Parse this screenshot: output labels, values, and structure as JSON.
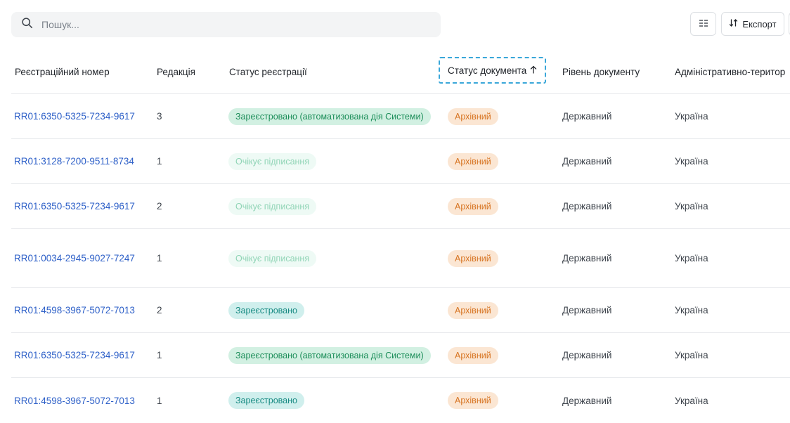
{
  "toolbar": {
    "search_placeholder": "Пошук...",
    "export_label": "Експорт"
  },
  "table": {
    "columns": [
      "Реєстраційний номер",
      "Редакція",
      "Статус реєстрації",
      "Статус документа",
      "Рівень документу",
      "Адміністративно-територ"
    ],
    "rows": [
      {
        "number": "RR01:6350-5325-7234-9617",
        "edition": "3",
        "reg_status": "Зареєстровано (автоматизована дія Системи)",
        "reg_variant": "green",
        "doc_status": "Архівний",
        "level": "Державний",
        "admin": "Україна"
      },
      {
        "number": "RR01:3128-7200-9511-8734",
        "edition": "1",
        "reg_status": "Очікує підписання",
        "reg_variant": "pale",
        "doc_status": "Архівний",
        "level": "Державний",
        "admin": "Україна"
      },
      {
        "number": "RR01:6350-5325-7234-9617",
        "edition": "2",
        "reg_status": "Очікує підписання",
        "reg_variant": "pale",
        "doc_status": "Архівний",
        "level": "Державний",
        "admin": "Україна"
      },
      {
        "number": "RR01:0034-2945-9027-7247",
        "edition": "1",
        "reg_status": "Очікує підписання",
        "reg_variant": "pale",
        "doc_status": "Архівний",
        "level": "Державний",
        "admin": "Україна"
      },
      {
        "number": "RR01:4598-3967-5072-7013",
        "edition": "2",
        "reg_status": "Зареєстровано",
        "reg_variant": "teal",
        "doc_status": "Архівний",
        "level": "Державний",
        "admin": "Україна"
      },
      {
        "number": "RR01:6350-5325-7234-9617",
        "edition": "1",
        "reg_status": "Зареєстровано (автоматизована дія Системи)",
        "reg_variant": "green",
        "doc_status": "Архівний",
        "level": "Державний",
        "admin": "Україна"
      },
      {
        "number": "RR01:4598-3967-5072-7013",
        "edition": "1",
        "reg_status": "Зареєстровано",
        "reg_variant": "teal",
        "doc_status": "Архівний",
        "level": "Державний",
        "admin": "Україна"
      }
    ]
  },
  "icons": {
    "search": "search-icon",
    "columns": "columns-icon",
    "sort": "sort-icon",
    "sort_asc": "arrow-up-icon"
  },
  "colors": {
    "link": "#2e60c8",
    "focus_outline": "#3aa7d9",
    "badge_green_bg": "#d2f0e2",
    "badge_teal_bg": "#d0efed",
    "badge_orange_bg": "#fbe6d3"
  }
}
